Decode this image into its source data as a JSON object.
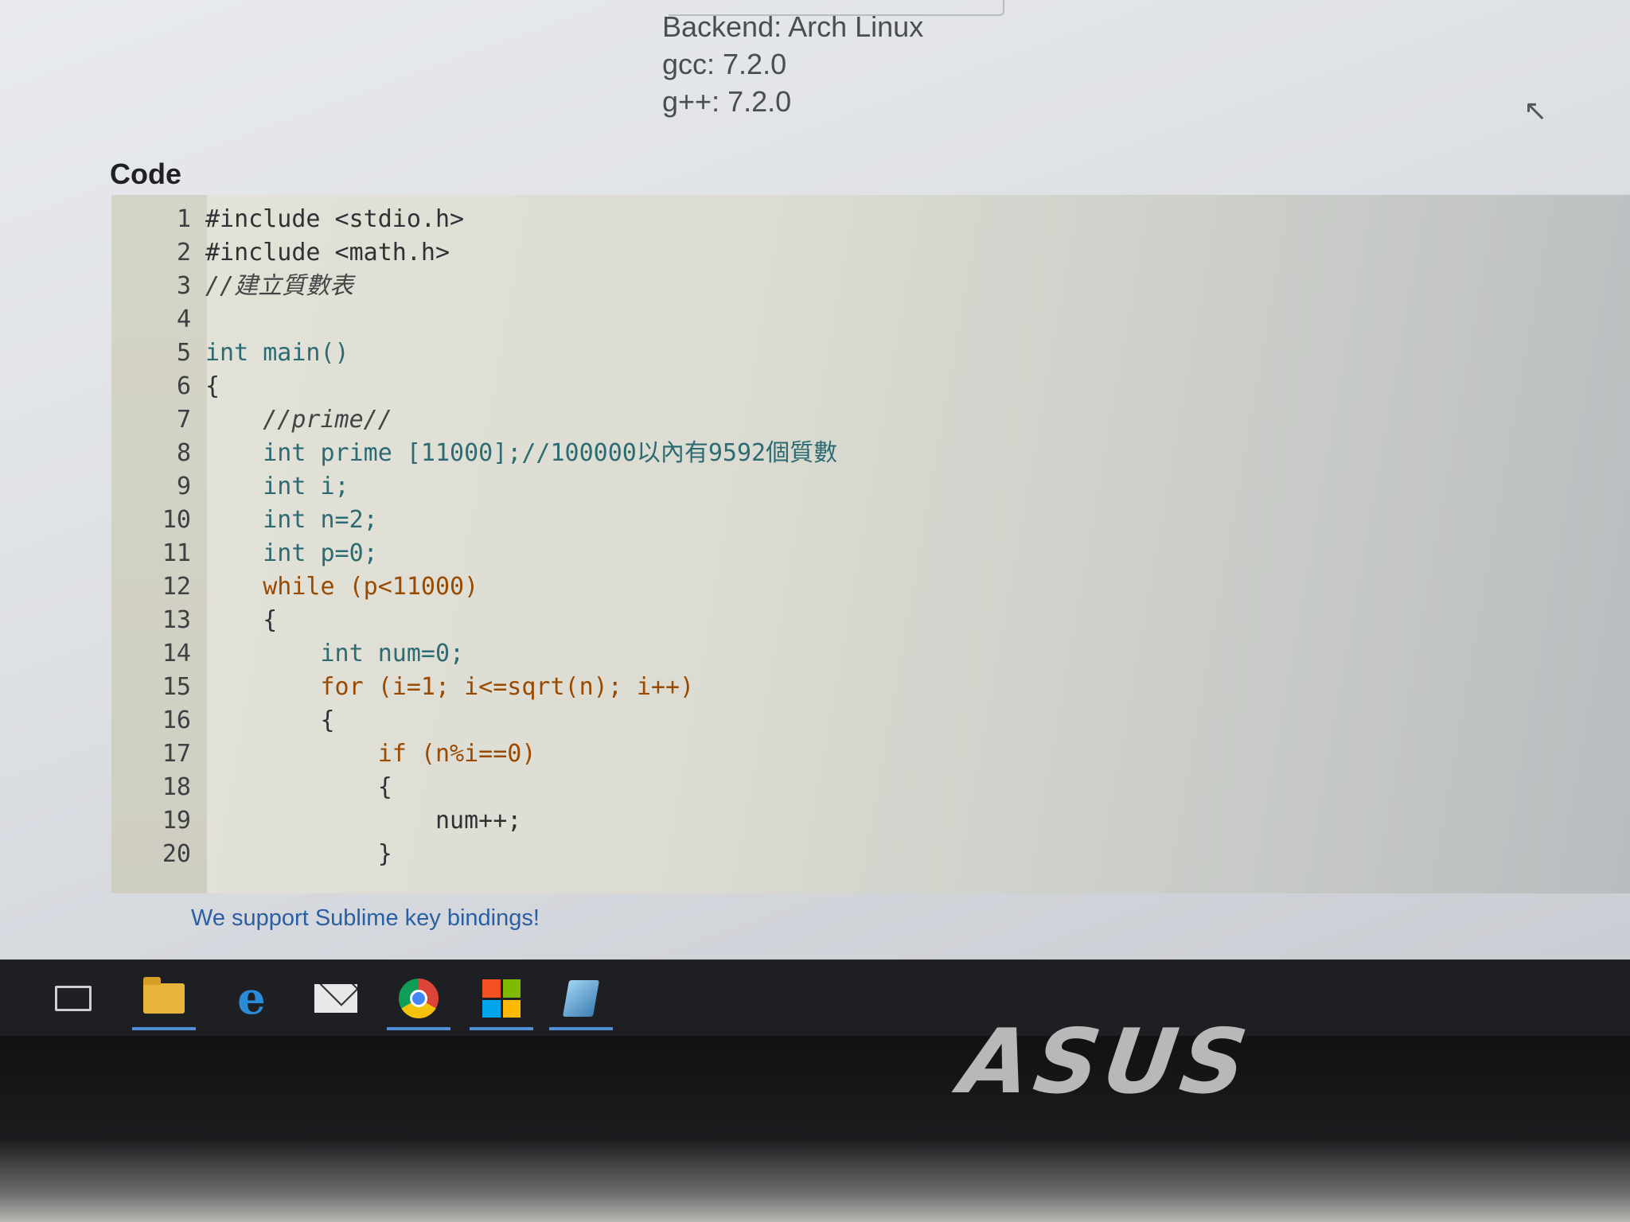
{
  "header": {
    "backend_label": "Backend: Arch Linux",
    "gcc_label": "gcc: 7.2.0",
    "gpp_label": "g++: 7.2.0"
  },
  "code_section": {
    "heading": "Code",
    "lines": [
      {
        "no": "1",
        "text": "#include <stdio.h>"
      },
      {
        "no": "2",
        "text": "#include <math.h>"
      },
      {
        "no": "3",
        "text": "//建立質數表"
      },
      {
        "no": "4",
        "text": ""
      },
      {
        "no": "5",
        "text": "int main()"
      },
      {
        "no": "6",
        "text": "{"
      },
      {
        "no": "7",
        "text": "    //prime//"
      },
      {
        "no": "8",
        "text": "    int prime [11000];//100000以內有9592個質數"
      },
      {
        "no": "9",
        "text": "    int i;"
      },
      {
        "no": "10",
        "text": "    int n=2;"
      },
      {
        "no": "11",
        "text": "    int p=0;"
      },
      {
        "no": "12",
        "text": "    while (p<11000)"
      },
      {
        "no": "13",
        "text": "    {"
      },
      {
        "no": "14",
        "text": "        int num=0;"
      },
      {
        "no": "15",
        "text": "        for (i=1; i<=sqrt(n); i++)"
      },
      {
        "no": "16",
        "text": "        {"
      },
      {
        "no": "17",
        "text": "            if (n%i==0)"
      },
      {
        "no": "18",
        "text": "            {"
      },
      {
        "no": "19",
        "text": "                num++;"
      },
      {
        "no": "20",
        "text": "            }"
      }
    ]
  },
  "footer": {
    "link_text": "We support Sublime key bindings!"
  },
  "taskbar": {
    "items": [
      {
        "icon": "task-view-icon"
      },
      {
        "icon": "file-explorer-icon"
      },
      {
        "icon": "internet-explorer-icon"
      },
      {
        "icon": "mail-icon"
      },
      {
        "icon": "chrome-icon"
      },
      {
        "icon": "store-icon"
      },
      {
        "icon": "app-icon"
      }
    ]
  },
  "device": {
    "brand": "ASUS"
  },
  "colors": {
    "keyword": "#2d6b73",
    "control": "#9a4a00",
    "number": "#a8201c",
    "link": "#2a5fa3",
    "taskbar_accent": "#4e8fd6"
  }
}
